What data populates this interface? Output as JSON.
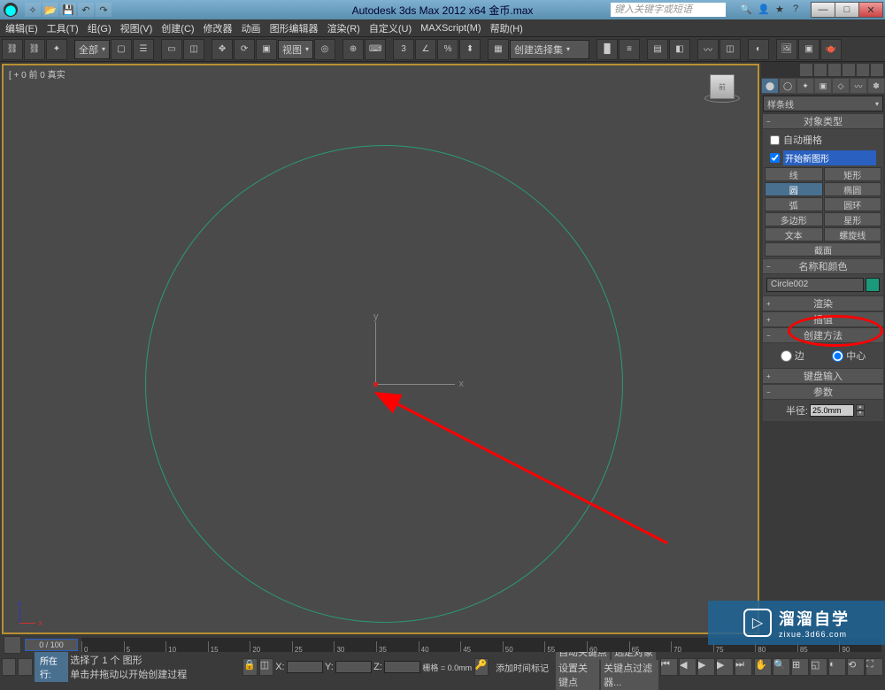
{
  "titlebar": {
    "title": "Autodesk 3ds Max 2012 x64   金币.max",
    "search_placeholder": "键入关键字或短语",
    "min": "—",
    "max": "□",
    "close": "✕"
  },
  "menu": {
    "items": [
      "编辑(E)",
      "工具(T)",
      "组(G)",
      "视图(V)",
      "创建(C)",
      "修改器",
      "动画",
      "图形编辑器",
      "渲染(R)",
      "自定义(U)",
      "MAXScript(M)",
      "帮助(H)"
    ]
  },
  "toolbar": {
    "selection_filter": "全部",
    "view_label": "视图",
    "named_sets": "创建选择集"
  },
  "viewport": {
    "label": "[ + 0 前 0 真实"
  },
  "panel": {
    "category": "样条线",
    "rollouts": {
      "object_type": "对象类型",
      "auto_grid": "自动栅格",
      "start_new": "开始新图形",
      "name_color": "名称和颜色",
      "render": "渲染",
      "interpolation": "插值",
      "creation_method": "创建方法",
      "keyboard_entry": "键盘输入",
      "parameters": "参数"
    },
    "shapes": {
      "line": "线",
      "rectangle": "矩形",
      "circle": "圆",
      "ellipse": "椭圆",
      "arc": "弧",
      "donut": "圆环",
      "ngon": "多边形",
      "star": "星形",
      "text": "文本",
      "helix": "螺旋线",
      "section": "截面"
    },
    "object_name": "Circle002",
    "creation": {
      "edge": "边",
      "center": "中心"
    },
    "param": {
      "radius_label": "半径:",
      "radius_value": "25.0mm"
    }
  },
  "timeline": {
    "marker": "0 / 100",
    "ticks": [
      "0",
      "5",
      "10",
      "15",
      "20",
      "25",
      "30",
      "35",
      "40",
      "45",
      "50",
      "55",
      "60",
      "65",
      "70",
      "75",
      "80",
      "85",
      "90"
    ]
  },
  "status": {
    "row_label": "所在行:",
    "line1": "选择了 1 个 图形",
    "line2": "单击并拖动以开始创建过程",
    "add_time_tag": "添加时间标记",
    "x": "X:",
    "y": "Y:",
    "z": "Z:",
    "grid": "栅格 = 0.0mm",
    "autokey": "自动关键点",
    "selected": "选定对象",
    "setkey": "设置关键点",
    "keyfilter": "关键点过滤器..."
  },
  "watermark": {
    "big": "溜溜自学",
    "small": "zixue.3d66.com"
  }
}
